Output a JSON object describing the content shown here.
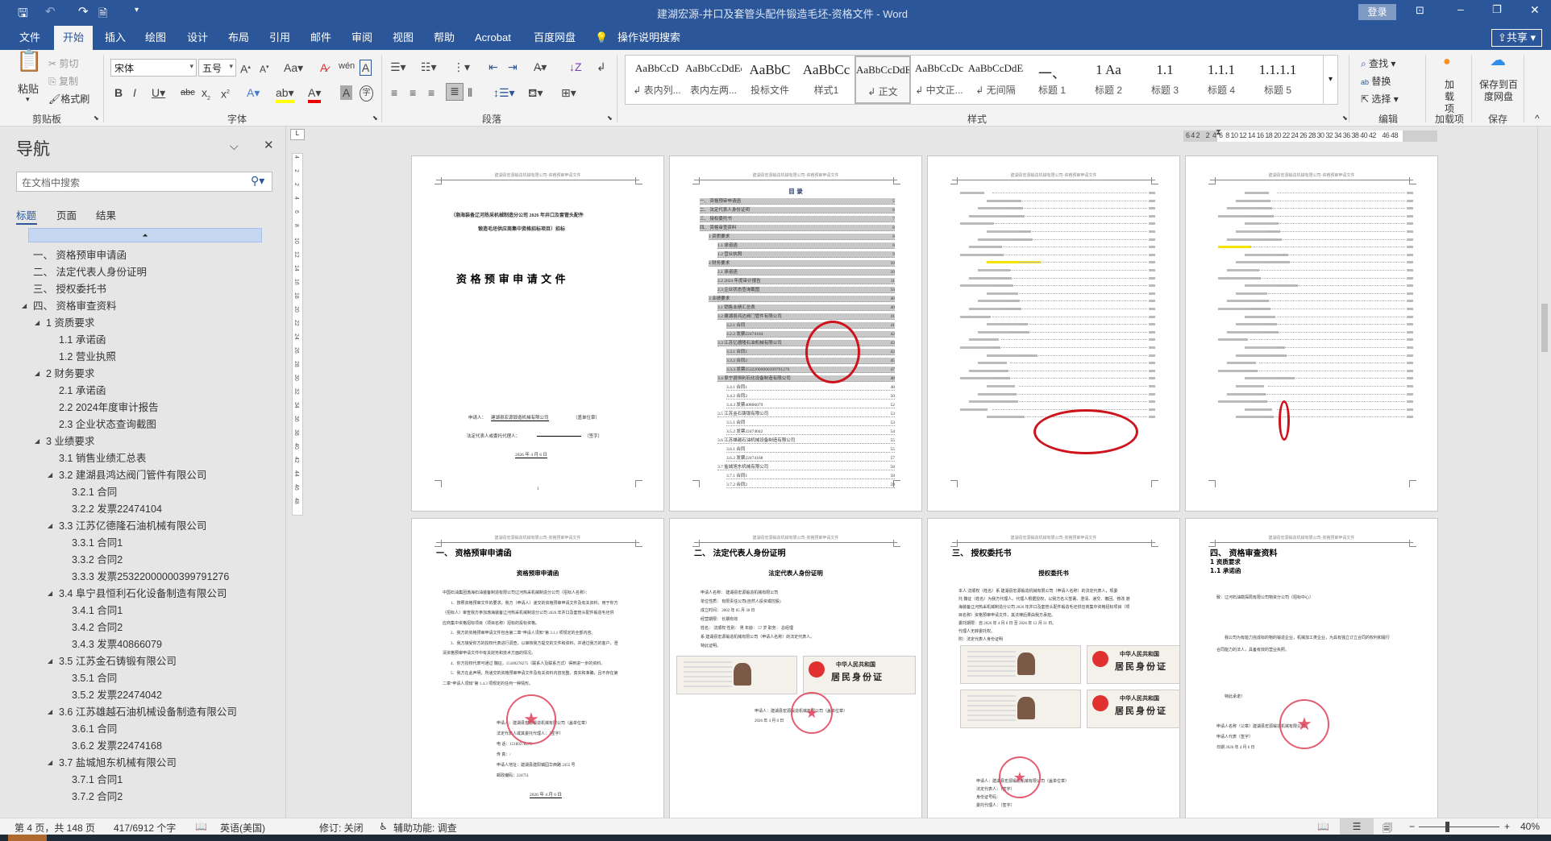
{
  "titlebar": {
    "doc_title": "建湖宏源-井口及套管头配件锻造毛坯-资格文件  -  Word",
    "login": "登录"
  },
  "tabs": [
    "文件",
    "开始",
    "插入",
    "绘图",
    "设计",
    "布局",
    "引用",
    "邮件",
    "审阅",
    "视图",
    "帮助",
    "Acrobat",
    "百度网盘"
  ],
  "tell_me": "操作说明搜索",
  "share": "共享",
  "ribbon": {
    "clipboard": {
      "paste": "粘贴",
      "cut": "剪切",
      "copy": "复制",
      "format_painter": "格式刷",
      "label": "剪贴板"
    },
    "font": {
      "name": "宋体",
      "size": "五号",
      "label": "字体"
    },
    "paragraph": {
      "label": "段落"
    },
    "styles": {
      "label": "样式",
      "items": [
        {
          "preview": "AaBbCcD",
          "name": "↲ 表内列..."
        },
        {
          "preview": "AaBbCcDdEe",
          "name": "表内左两..."
        },
        {
          "preview": "AaBbC",
          "name": "投标文件"
        },
        {
          "preview": "AaBbCc",
          "name": "样式1"
        },
        {
          "preview": "AaBbCcDdE",
          "name": "↲ 正文"
        },
        {
          "preview": "AaBbCcDc",
          "name": "↲ 中文正..."
        },
        {
          "preview": "AaBbCcDdE",
          "name": "↲ 无间隔"
        },
        {
          "preview": "一、",
          "name": "标题 1"
        },
        {
          "preview": "1  Aa",
          "name": "标题 2"
        },
        {
          "preview": "1.1",
          "name": "标题 3"
        },
        {
          "preview": "1.1.1",
          "name": "标题 4"
        },
        {
          "preview": "1.1.1.1",
          "name": "标题 5"
        }
      ]
    },
    "editing": {
      "find": "查找",
      "replace": "替换",
      "select": "选择",
      "label": "编辑"
    },
    "addins": {
      "button": "加载项",
      "label": "加载项"
    },
    "save": {
      "button": "保存到百度网盘",
      "label": "保存"
    }
  },
  "nav": {
    "title": "导航",
    "search_placeholder": "在文档中搜索",
    "tabs": [
      "标题",
      "页面",
      "结果"
    ],
    "items": [
      {
        "t": "一、  资格预审申请函",
        "l": 0
      },
      {
        "t": "二、  法定代表人身份证明",
        "l": 0
      },
      {
        "t": "三、  授权委托书",
        "l": 0
      },
      {
        "t": "四、  资格审查资料",
        "l": 0,
        "c": 1
      },
      {
        "t": "1 资质要求",
        "l": 1,
        "c": 1
      },
      {
        "t": "1.1 承诺函",
        "l": 2
      },
      {
        "t": "1.2 营业执照",
        "l": 2
      },
      {
        "t": "2 财务要求",
        "l": 1,
        "c": 1
      },
      {
        "t": "2.1 承诺函",
        "l": 2
      },
      {
        "t": "2.2 2024年度审计报告",
        "l": 2
      },
      {
        "t": "2.3 企业状态查询截图",
        "l": 2
      },
      {
        "t": "3 业绩要求",
        "l": 1,
        "c": 1
      },
      {
        "t": "3.1 销售业绩汇总表",
        "l": 2
      },
      {
        "t": "3.2 建湖县鸿达阀门管件有限公司",
        "l": 2,
        "c": 1
      },
      {
        "t": "3.2.1 合同",
        "l": 3
      },
      {
        "t": "3.2.2 发票22474104",
        "l": 3
      },
      {
        "t": "3.3 江苏亿德隆石油机械有限公司",
        "l": 2,
        "c": 1
      },
      {
        "t": "3.3.1 合同1",
        "l": 3
      },
      {
        "t": "3.3.2 合同2",
        "l": 3
      },
      {
        "t": "3.3.3 发票25322000000399791276",
        "l": 3
      },
      {
        "t": "3.4 阜宁县恒利石化设备制造有限公司",
        "l": 2,
        "c": 1
      },
      {
        "t": "3.4.1 合同1",
        "l": 3
      },
      {
        "t": "3.4.2 合同2",
        "l": 3
      },
      {
        "t": "3.4.3 发票40866079",
        "l": 3
      },
      {
        "t": "3.5 江苏金石铸锻有限公司",
        "l": 2,
        "c": 1
      },
      {
        "t": "3.5.1 合同",
        "l": 3
      },
      {
        "t": "3.5.2 发票22474042",
        "l": 3
      },
      {
        "t": "3.6 江苏雄越石油机械设备制造有限公司",
        "l": 2,
        "c": 1
      },
      {
        "t": "3.6.1 合同",
        "l": 3
      },
      {
        "t": "3.6.2 发票22474168",
        "l": 3
      },
      {
        "t": "3.7 盐城旭东机械有限公司",
        "l": 2,
        "c": 1
      },
      {
        "t": "3.7.1 合同1",
        "l": 3
      },
      {
        "t": "3.7.2 合同2",
        "l": 3
      }
    ]
  },
  "ruler": {
    "h": "6 4 2    2  4  6  8 10 12 14 16 18 20 22 24 26 28 30 32 34 36 38 40 42    46 48",
    "v": [
      "4",
      "2",
      "2",
      "4",
      "6",
      "8",
      "10",
      "12",
      "14",
      "16",
      "18",
      "20",
      "22",
      "24",
      "26",
      "28",
      "30",
      "32",
      "34",
      "36",
      "38",
      "40",
      "42",
      "44",
      "46",
      "48"
    ]
  },
  "doc": {
    "header": "建湖县宏源锻造机械有限公司-资格预审申请文件",
    "p1": {
      "sub1": "（渤海装备辽河热采机械制造分公司 2026 年井口及套管头配件",
      "sub2": "锻造毛坯供应商集中资格招标项目）招标",
      "title": "资 格 预 审 申 请 文 件",
      "applicant_label": "申请人：",
      "applicant": "建湖县宏源锻造机械有限公司",
      "seal": "（盖单位章）",
      "rep_label": "法定代表人或委托代理人：",
      "sign": "（签字）",
      "date": "2026 年 4 月 6 日",
      "pageno": "1"
    },
    "toc": {
      "title": "目 录",
      "pageno": "2",
      "entries": [
        {
          "t": "一、 资格预审申请函",
          "p": "5",
          "l": 0,
          "h": 1
        },
        {
          "t": "二、 法定代表人身份证明",
          "p": "6",
          "l": 0,
          "h": 1
        },
        {
          "t": "三、 授权委托书",
          "p": "7",
          "l": 0,
          "h": 1
        },
        {
          "t": "四、 资格审查资料",
          "p": "8",
          "l": 0,
          "h": 1
        },
        {
          "t": "1 资质要求",
          "p": "8",
          "l": 1,
          "h": 1
        },
        {
          "t": "1.1 承诺函",
          "p": "8",
          "l": 2,
          "h": 1
        },
        {
          "t": "1.2 营业执照",
          "p": "9",
          "l": 2,
          "h": 1
        },
        {
          "t": "2 财务要求",
          "p": "10",
          "l": 1,
          "h": 1
        },
        {
          "t": "2.1 承诺函",
          "p": "10",
          "l": 2,
          "h": 1
        },
        {
          "t": "2.2 2024 年度审计报告",
          "p": "11",
          "l": 2,
          "h": 1
        },
        {
          "t": "2.3 企业状态查询截图",
          "p": "34",
          "l": 2,
          "h": 1
        },
        {
          "t": "3 业绩要求",
          "p": "40",
          "l": 1,
          "h": 1
        },
        {
          "t": "3.1 销售业绩汇总表",
          "p": "40",
          "l": 2,
          "h": 1
        },
        {
          "t": "3.2 建湖县鸿达阀门管件有限公司",
          "p": "41",
          "l": 2,
          "h": 1
        },
        {
          "t": "3.2.1 合同",
          "p": "41",
          "l": 3,
          "h": 1
        },
        {
          "t": "3.2.2 发票22474104",
          "p": "42",
          "l": 3,
          "h": 1
        },
        {
          "t": "3.3 江苏亿德隆石油机械有限公司",
          "p": "43",
          "l": 2,
          "h": 1
        },
        {
          "t": "3.3.1 合同1",
          "p": "43",
          "l": 3,
          "h": 1
        },
        {
          "t": "3.3.2 合同2",
          "p": "45",
          "l": 3,
          "h": 1
        },
        {
          "t": "3.3.3 发票25322000000399791276",
          "p": "47",
          "l": 3,
          "h": 1
        },
        {
          "t": "3.4 阜宁县恒利石化设备制造有限公司",
          "p": "48",
          "l": 2,
          "h": 1
        },
        {
          "t": "3.4.1 合同1",
          "p": "48",
          "l": 3
        },
        {
          "t": "3.4.2 合同2",
          "p": "50",
          "l": 3
        },
        {
          "t": "3.4.3 发票40866079",
          "p": "52",
          "l": 3
        },
        {
          "t": "3.5 江苏金石铸锻有限公司",
          "p": "53",
          "l": 2
        },
        {
          "t": "3.5.1 合同",
          "p": "53",
          "l": 3
        },
        {
          "t": "3.5.2 发票22474042",
          "p": "54",
          "l": 3
        },
        {
          "t": "3.6 江苏雄越石油机械设备制造有限公司",
          "p": "55",
          "l": 2
        },
        {
          "t": "3.6.1 合同",
          "p": "55",
          "l": 3
        },
        {
          "t": "3.6.2 发票22474168",
          "p": "57",
          "l": 3
        },
        {
          "t": "3.7 盐城旭东机械有限公司",
          "p": "58",
          "l": 2
        },
        {
          "t": "3.7.1 合同1",
          "p": "58",
          "l": 3
        },
        {
          "t": "3.7.2 合同2",
          "p": "59",
          "l": 3
        }
      ]
    },
    "p5": {
      "h1": "一、 资格预审申请函",
      "title": "资格预审申请函",
      "lines": [
        "中国石油集团渤海石油装备制造有限公司辽河热采机械制造分公司（招标人名称）：",
        "1．按照资格预审文件的要求，我方（申请人）递交的资格预审申请文件及有关资料，用于你方",
        "（招标人）审查我方参加渤海装备辽河热采机械制造分公司 2026 年井口及套管头配件锻造毛坯供",
        "应商集中资格招标项目（项目名称）招标的投标资格。",
        "2．我方的资格预审申请文件包含第二章“申请人须知”第 3.1.1 项规定的全部内容。",
        "3．我方接受你方的授权代表进行调查，以审核我方提交的文件和资料，并通过我方的客户，澄",
        "清资格预审申请文件中有关财务和技术方面的情况。",
        "4．你方授权代表可通过 魏征，15189278275（联系人及联系方式）得到进一步的资料。",
        "5．我方在此声明，所递交的资格预审申请文件及有关资料内容完整、真实和准确，且不存在第",
        "二章“申请人须知”第 1.4.3 项规定的任何一种情形。"
      ],
      "sign": [
        "申请人：建湖县宏源锻造机械有限公司（盖单位章）",
        "法定代表人或其委托代理人：（签字）",
        "电    话：15189278275",
        "传    真：/",
        "申请人地址：建湖县建阳镇园华西路 2455 号",
        "邮政编码：224751"
      ],
      "date": "2026 年 4 月 6 日"
    },
    "p6": {
      "h1": "二、 法定代表人身份证明",
      "title": "法定代表人身份证明",
      "lines": [
        "申请人名称： 建湖县宏源锻造机械有限公司",
        "单位性质： 有限责任公司(自然人投资或控股)",
        "成立时间： 2002 年 05 月 30 日",
        "经营期限： 长期有效",
        "姓名： 沈顺权   性别： 男   年龄： 57 岁   职务： 总经理",
        "系 建湖县宏源锻造机械有限公司（申请人名称）的法定代表人。",
        "特此证明。"
      ],
      "sign": [
        "申请人：建湖县宏源锻造机械有限公司（盖单位章）",
        "2026 年 4 月 6 日"
      ]
    },
    "p7": {
      "h1": "三、 授权委托书",
      "title": "授权委托书",
      "lines": [
        "本人 沈顺权（姓名）系 建湖县宏源锻造机械有限公司（申请人名称）的法定代表人，现委",
        "托 魏征（姓名）为我方代理人。代理人根据授权，以我方名义签署、澄清、递交、撤回、修改 渤",
        "海装备辽河热采机械制造分公司 2026 年井口及套管头配件锻造毛坯供应商集中资格招标项目（项",
        "目名称）资格预审申请文件，其法律后果由我方承担。",
        "委托期限：自 2026 年 4 月 6 日 至 2026 年 12 月 31 日。",
        "代理人无转委托权。",
        "附：法定代表人身份证明"
      ],
      "sign": [
        "申请人：建湖县宏源锻造机械有限公司（盖单位章）",
        "法定代表人：（签字）",
        "身份证号码：",
        "委托代理人：（签字）"
      ]
    },
    "idcard": {
      "country": "中华人民共和国",
      "name": "居民身份证"
    },
    "p8": {
      "h1": "四、 资格审查资料",
      "h2": "1 资质要求",
      "h3": "1.1 承诺函",
      "to": "致：辽河石油勘探局有限公司物资分公司（招标中心）",
      "lines": [
        "我公司为有能力完成标的物的锻造企业，机械加工类企业，为具有独立订立合同的权利和履行",
        "合同能力的法人，具备有效的营业执照。"
      ],
      "end": "特此承诺！",
      "sign": [
        "申请人名称（公章）建湖县宏源锻造机械有限公司",
        "申请人代表（签字）",
        "日期  2026 年 4 月 6 日"
      ]
    }
  },
  "status": {
    "page": "第 4 页，共 148 页",
    "words": "417/6912 个字",
    "language": "英语(美国)",
    "track": "修订: 关闭",
    "accessibility": "辅助功能: 调查",
    "zoom": "40%",
    "zoom_level": 40
  }
}
